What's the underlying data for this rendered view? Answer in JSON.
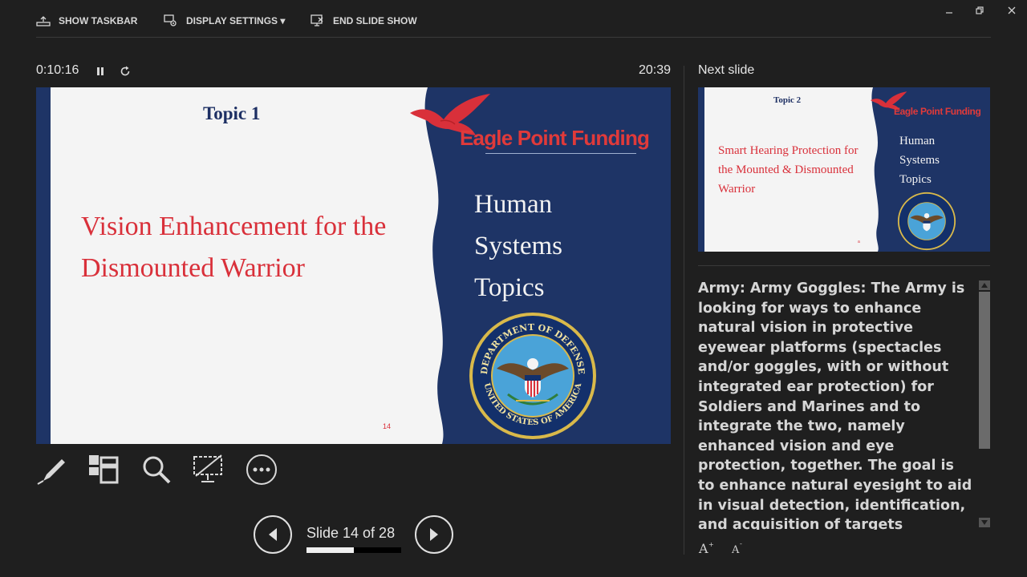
{
  "toolbar": {
    "show_taskbar": "SHOW TASKBAR",
    "display_settings": "DISPLAY SETTINGS ▾",
    "end_slide_show": "END SLIDE SHOW"
  },
  "timer": {
    "elapsed": "0:10:16",
    "clock": "20:39"
  },
  "current_slide": {
    "topic": "Topic 1",
    "title": "Vision Enhancement for the Dismounted Warrior",
    "brand": "Eagle Point Funding",
    "right_text": [
      "Human",
      "Systems",
      "Topics"
    ],
    "page_number": "14",
    "seal_top": "DEPARTMENT OF DEFENSE",
    "seal_bottom": "UNITED STATES OF AMERICA"
  },
  "tools": [
    "pen-tool",
    "see-all-slides",
    "zoom",
    "black-screen",
    "more-options"
  ],
  "navigation": {
    "slide_label": "Slide 14 of 28",
    "progress_fraction": 0.5
  },
  "next_slide": {
    "label": "Next slide",
    "topic": "Topic 2",
    "title": "Smart Hearing Protection for the Mounted & Dismounted Warrior",
    "brand": "Eagle Point Funding",
    "right_text": [
      "Human",
      "Systems",
      "Topics"
    ],
    "page_number": "a"
  },
  "notes": {
    "text": "Army: Army Goggles:  The Army is looking for ways to enhance natural vision in protective eyewear platforms (spectacles and/or goggles, with or without integrated ear protection) for Soldiers and Marines and to integrate the two, namely enhanced vision and eye protection, together. The goal is to enhance natural eyesight to aid in visual detection, identification, and acquisition of targets"
  },
  "colors": {
    "background": "#1f1f1f",
    "slide_navy": "#1e3466",
    "slide_red": "#d9303a",
    "brand_red": "#e03a3a"
  }
}
